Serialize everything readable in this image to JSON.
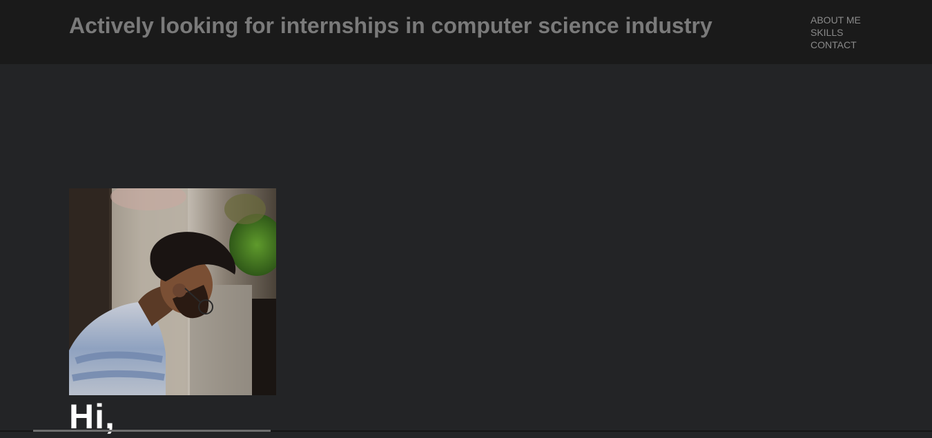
{
  "header": {
    "title": "Actively looking for internships in computer science industry"
  },
  "nav": {
    "items": [
      {
        "label": "ABOUT ME"
      },
      {
        "label": "SKILLS"
      },
      {
        "label": "CONTACT"
      }
    ]
  },
  "hero": {
    "greeting": "Hi,"
  },
  "colors": {
    "page_background": "#232426",
    "header_background": "#1a1a1a",
    "title_text": "#7a7a7a",
    "nav_text": "#8a8a8a",
    "greeting_text": "#ffffff"
  }
}
